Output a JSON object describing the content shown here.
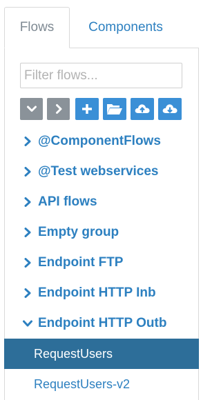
{
  "tabs": {
    "flows": "Flows",
    "components": "Components"
  },
  "filter": {
    "placeholder": "Filter flows...",
    "value": ""
  },
  "toolbar": {
    "buttons": [
      {
        "name": "collapse-all",
        "icon": "chevron-down-icon",
        "color": "#8a9299"
      },
      {
        "name": "expand-all",
        "icon": "chevron-right-icon",
        "color": "#8a9299"
      },
      {
        "name": "add",
        "icon": "plus-icon",
        "color": "#3a8fd6"
      },
      {
        "name": "open-folder",
        "icon": "folder-open-icon",
        "color": "#3a8fd6"
      },
      {
        "name": "upload",
        "icon": "cloud-upload-icon",
        "color": "#3a8fd6"
      },
      {
        "name": "download",
        "icon": "cloud-download-icon",
        "color": "#3a8fd6"
      }
    ]
  },
  "tree": {
    "groups": [
      {
        "label": "@ComponentFlows",
        "expanded": false
      },
      {
        "label": "@Test webservices",
        "expanded": false
      },
      {
        "label": "API flows",
        "expanded": false
      },
      {
        "label": "Empty group",
        "expanded": false
      },
      {
        "label": "Endpoint FTP",
        "expanded": false
      },
      {
        "label": "Endpoint HTTP Inb",
        "expanded": false
      },
      {
        "label": "Endpoint HTTP Outb",
        "expanded": true
      }
    ],
    "items": [
      {
        "label": "RequestUsers",
        "selected": true
      },
      {
        "label": "RequestUsers-v2",
        "selected": false
      }
    ]
  },
  "colors": {
    "link": "#2d80c0",
    "selected_bg": "#2d6e99",
    "button_blue": "#3a8fd6",
    "button_gray": "#8a9299"
  }
}
